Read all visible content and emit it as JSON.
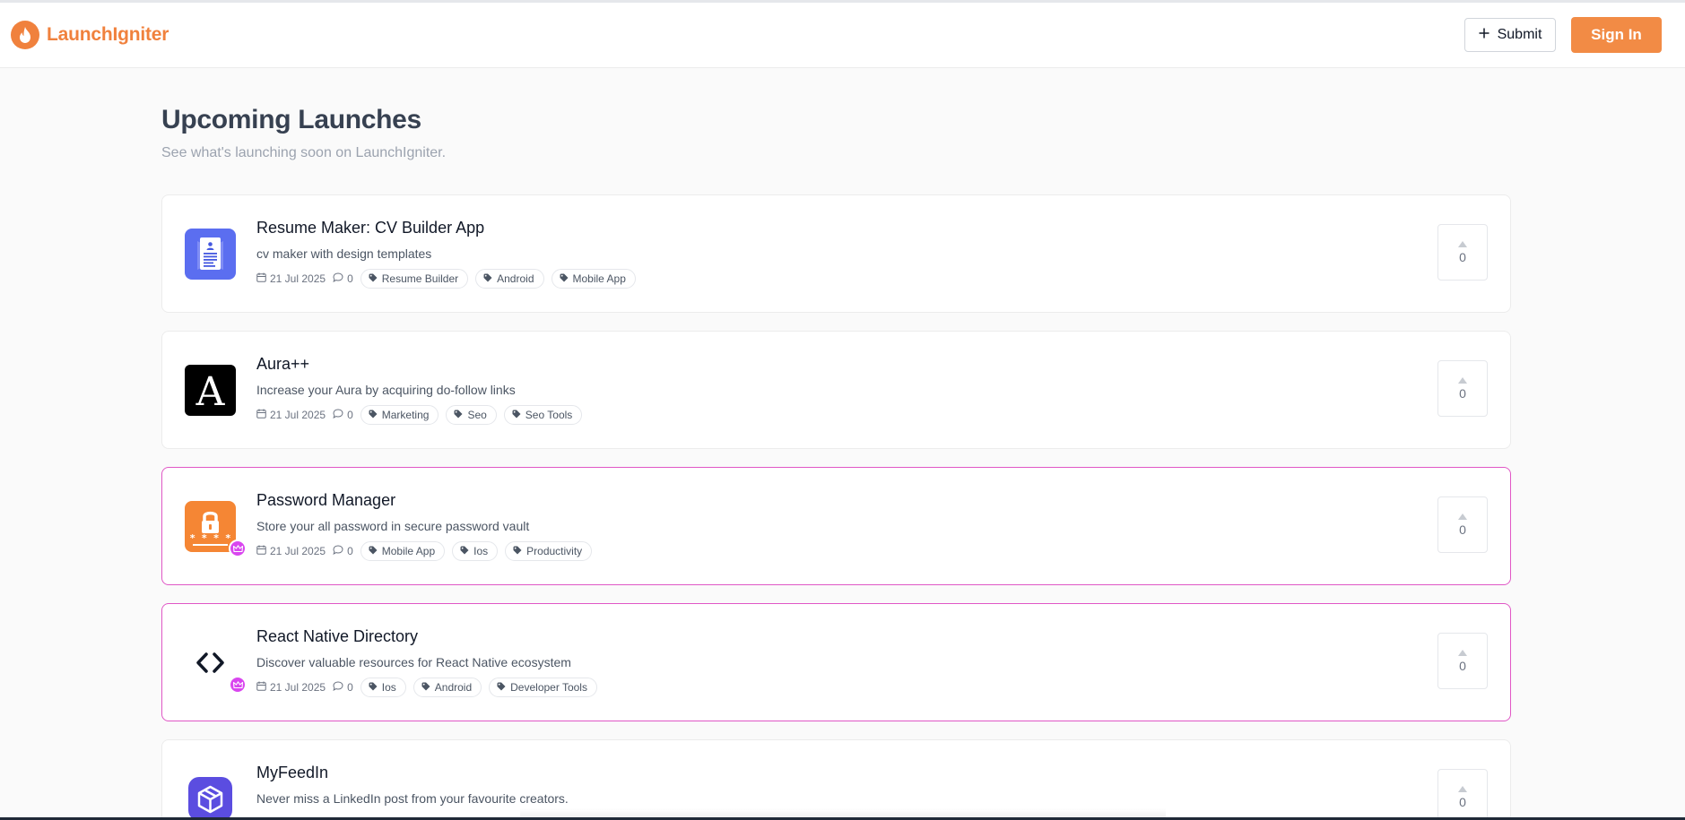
{
  "header": {
    "logo_text": "LaunchIgniter",
    "submit_label": "Submit",
    "signin_label": "Sign In"
  },
  "page": {
    "title": "Upcoming Launches",
    "subtitle": "See what's launching soon on LaunchIgniter."
  },
  "colors": {
    "brand": "#f0813d",
    "featured_border": "#e057c6"
  },
  "launches": [
    {
      "title": "Resume Maker: CV Builder App",
      "description": "cv maker with design templates",
      "date": "21 Jul 2025",
      "comments": "0",
      "tags": [
        "Resume Builder",
        "Android",
        "Mobile App"
      ],
      "votes": "0",
      "featured": false,
      "icon": "resume-document-icon"
    },
    {
      "title": "Aura++",
      "description": "Increase your Aura by acquiring do-follow links",
      "date": "21 Jul 2025",
      "comments": "0",
      "tags": [
        "Marketing",
        "Seo",
        "Seo Tools"
      ],
      "votes": "0",
      "featured": false,
      "icon": "letter-a-logo-icon",
      "icon_letter": "A"
    },
    {
      "title": "Password Manager",
      "description": "Store your all password in secure password vault",
      "date": "21 Jul 2025",
      "comments": "0",
      "tags": [
        "Mobile App",
        "Ios",
        "Productivity"
      ],
      "votes": "0",
      "featured": true,
      "icon": "padlock-password-icon",
      "icon_text": "* * * *"
    },
    {
      "title": "React Native Directory",
      "description": "Discover valuable resources for React Native ecosystem",
      "date": "21 Jul 2025",
      "comments": "0",
      "tags": [
        "Ios",
        "Android",
        "Developer Tools"
      ],
      "votes": "0",
      "featured": true,
      "icon": "code-brackets-icon"
    },
    {
      "title": "MyFeedIn",
      "description": "Never miss a LinkedIn post from your favourite creators.",
      "votes": "0",
      "featured": false,
      "icon": "cube-logo-icon"
    }
  ]
}
